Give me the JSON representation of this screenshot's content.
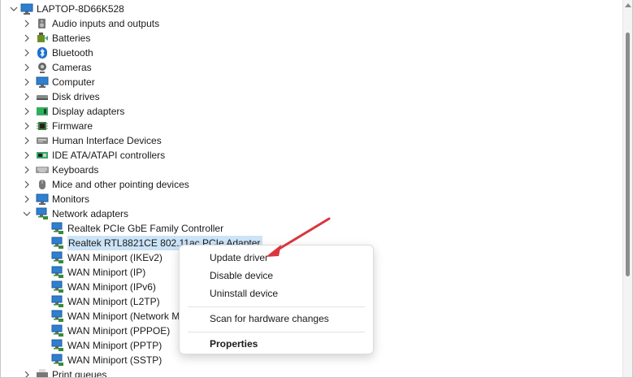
{
  "tree": {
    "root": {
      "label": "LAPTOP-8D66K528",
      "icon": "computer-icon"
    },
    "categories": [
      {
        "label": "Audio inputs and outputs",
        "icon": "speaker-icon",
        "expanded": false
      },
      {
        "label": "Batteries",
        "icon": "battery-icon",
        "expanded": false
      },
      {
        "label": "Bluetooth",
        "icon": "bluetooth-icon",
        "expanded": false
      },
      {
        "label": "Cameras",
        "icon": "camera-icon",
        "expanded": false
      },
      {
        "label": "Computer",
        "icon": "monitor-icon",
        "expanded": false
      },
      {
        "label": "Disk drives",
        "icon": "disk-drive-icon",
        "expanded": false
      },
      {
        "label": "Display adapters",
        "icon": "display-adapter-icon",
        "expanded": false
      },
      {
        "label": "Firmware",
        "icon": "chip-icon",
        "expanded": false
      },
      {
        "label": "Human Interface Devices",
        "icon": "hid-icon",
        "expanded": false
      },
      {
        "label": "IDE ATA/ATAPI controllers",
        "icon": "ide-controller-icon",
        "expanded": false
      },
      {
        "label": "Keyboards",
        "icon": "keyboard-icon",
        "expanded": false
      },
      {
        "label": "Mice and other pointing devices",
        "icon": "mouse-icon",
        "expanded": false
      },
      {
        "label": "Monitors",
        "icon": "monitor-icon",
        "expanded": false
      },
      {
        "label": "Network adapters",
        "icon": "network-adapter-icon",
        "expanded": true
      }
    ],
    "network_adapters": [
      {
        "label": "Realtek PCIe GbE Family Controller"
      },
      {
        "label": "Realtek RTL8821CE 802.11ac PCIe Adapter",
        "selected": true
      },
      {
        "label": "WAN Miniport (IKEv2)"
      },
      {
        "label": "WAN Miniport (IP)"
      },
      {
        "label": "WAN Miniport (IPv6)"
      },
      {
        "label": "WAN Miniport (L2TP)"
      },
      {
        "label": "WAN Miniport (Network Monitor)"
      },
      {
        "label": "WAN Miniport (PPPOE)"
      },
      {
        "label": "WAN Miniport (PPTP)"
      },
      {
        "label": "WAN Miniport (SSTP)"
      }
    ],
    "after": [
      {
        "label": "Print queues",
        "icon": "printer-icon",
        "expanded": false
      }
    ]
  },
  "context_menu": {
    "items": [
      {
        "label": "Update driver",
        "bold": false
      },
      {
        "label": "Disable device",
        "bold": false
      },
      {
        "label": "Uninstall device",
        "bold": false
      },
      {
        "label": "Scan for hardware changes",
        "bold": false
      },
      {
        "label": "Properties",
        "bold": true
      }
    ]
  },
  "colors": {
    "selection": "#cce4f7",
    "annotation_arrow": "#d9363e",
    "icon_blue": "#2f7fd1"
  }
}
